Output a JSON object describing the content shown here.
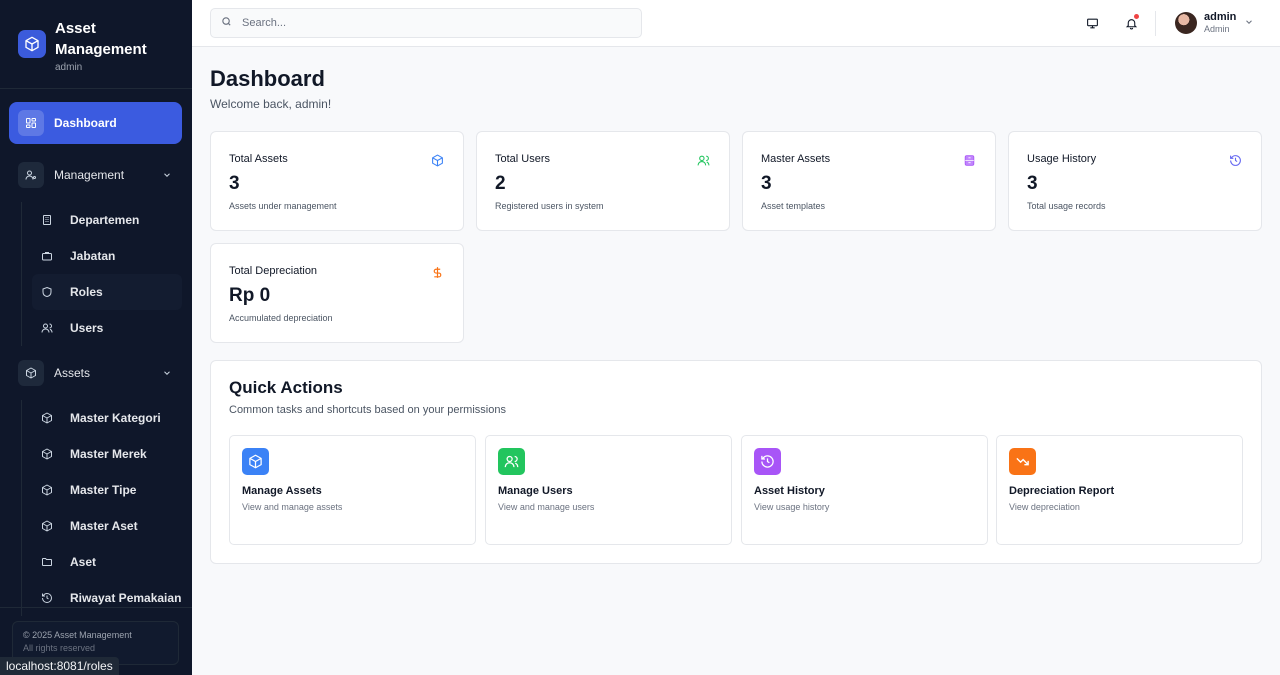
{
  "brand": {
    "title": "Asset Management",
    "subtitle": "admin"
  },
  "nav": {
    "dashboard": "Dashboard",
    "management": {
      "label": "Management",
      "items": [
        "Departemen",
        "Jabatan",
        "Roles",
        "Users"
      ]
    },
    "assets": {
      "label": "Assets",
      "items": [
        "Master Kategori",
        "Master Merek",
        "Master Tipe",
        "Master Aset",
        "Aset",
        "Riwayat Pemakaian"
      ]
    }
  },
  "footer": {
    "line1": "© 2025 Asset Management",
    "line2": "All rights reserved"
  },
  "status_url": "localhost:8081/roles",
  "search": {
    "placeholder": "Search..."
  },
  "user": {
    "name": "admin",
    "role": "Admin"
  },
  "page": {
    "title": "Dashboard",
    "subtitle": "Welcome back, admin!"
  },
  "stats": [
    {
      "label": "Total Assets",
      "value": "3",
      "desc": "Assets under management",
      "icon": "box-icon",
      "color": "#3b82f6"
    },
    {
      "label": "Total Users",
      "value": "2",
      "desc": "Registered users in system",
      "icon": "users-icon",
      "color": "#22c55e"
    },
    {
      "label": "Master Assets",
      "value": "3",
      "desc": "Asset templates",
      "icon": "database-icon",
      "color": "#a855f7"
    },
    {
      "label": "Usage History",
      "value": "3",
      "desc": "Total usage records",
      "icon": "history-icon",
      "color": "#6366f1"
    },
    {
      "label": "Total Depreciation",
      "value": "Rp 0",
      "desc": "Accumulated depreciation",
      "icon": "dollar-icon",
      "color": "#f97316"
    }
  ],
  "quick_actions": {
    "title": "Quick Actions",
    "subtitle": "Common tasks and shortcuts based on your permissions",
    "items": [
      {
        "name": "Manage Assets",
        "desc": "View and manage assets",
        "icon": "box-icon",
        "color": "#3b82f6"
      },
      {
        "name": "Manage Users",
        "desc": "View and manage users",
        "icon": "users-icon",
        "color": "#22c55e"
      },
      {
        "name": "Asset History",
        "desc": "View usage history",
        "icon": "history-icon",
        "color": "#a855f7"
      },
      {
        "name": "Depreciation Report",
        "desc": "View depreciation",
        "icon": "trending-down-icon",
        "color": "#f97316"
      }
    ]
  }
}
